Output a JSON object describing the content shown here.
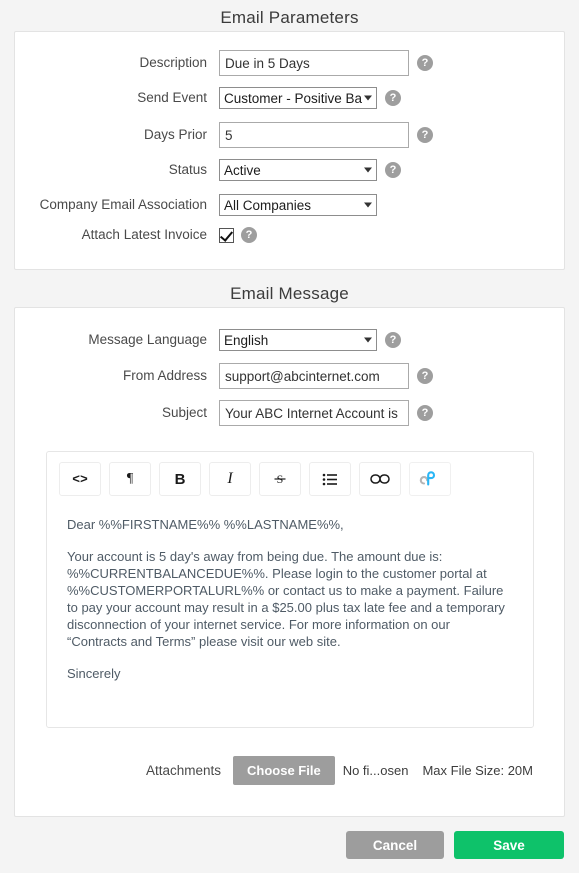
{
  "sections": {
    "parameters": {
      "title": "Email Parameters",
      "fields": [
        {
          "label": "Description",
          "type": "text",
          "value": "Due in 5 Days",
          "help": "?"
        },
        {
          "label": "Send Event",
          "type": "select",
          "value": "Customer - Positive Bа",
          "help": "?"
        },
        {
          "label": "Days Prior",
          "type": "text",
          "value": "5",
          "help": "?"
        },
        {
          "label": "Status",
          "type": "select",
          "value": "Active",
          "help": "?"
        },
        {
          "label": "Company Email Association",
          "type": "select",
          "value": "All Companies",
          "help": ""
        },
        {
          "label": "Attach Latest Invoice",
          "type": "checkbox",
          "value": "checked",
          "help": "?"
        }
      ]
    },
    "message": {
      "title": "Email Message",
      "fields": [
        {
          "label": "Message Language",
          "type": "select",
          "value": "English",
          "help": "?"
        },
        {
          "label": "From Address",
          "type": "text",
          "value": "support@abcinternet.com",
          "help": "?"
        },
        {
          "label": "Subject",
          "type": "text",
          "value": "Your ABC Internet Account is",
          "help": "?"
        }
      ],
      "editor": {
        "toolbar": [
          {
            "name": "code-icon",
            "glyph": "<>"
          },
          {
            "name": "paragraph-icon",
            "glyph": "¶"
          },
          {
            "name": "bold-icon",
            "glyph": "B"
          },
          {
            "name": "italic-icon",
            "glyph": "I"
          },
          {
            "name": "strikethrough-icon",
            "glyph": "S̶"
          },
          {
            "name": "bullet-list-icon",
            "glyph": "☰"
          },
          {
            "name": "link-icon",
            "glyph": "∞"
          },
          {
            "name": "brand-icon",
            "glyph": "℘"
          }
        ],
        "body": [
          "Dear %%FIRSTNAME%% %%LASTNAME%%,",
          "Your account is 5 day's away from being due. The amount due is: %%CURRENTBALANCEDUE%%. Please login to the customer portal at %%CUSTOMERPORTALURL%% or contact us to make a payment. Failure to pay your account may result in a $25.00 plus tax late fee and a temporary disconnection of your internet service. For more information on our “Contracts and Terms” please visit our web site.",
          "Sincerely"
        ]
      },
      "attachments": {
        "label": "Attachments",
        "choose_label": "Choose File",
        "file_status": "No fi...osen",
        "max_size": "Max File Size: 20M"
      }
    }
  },
  "footer": {
    "cancel_label": "Cancel",
    "save_label": "Save"
  },
  "colors": {
    "save_green": "#0ec26a",
    "gray_button": "#9d9d9d",
    "page_bg": "#f4f4f4"
  }
}
